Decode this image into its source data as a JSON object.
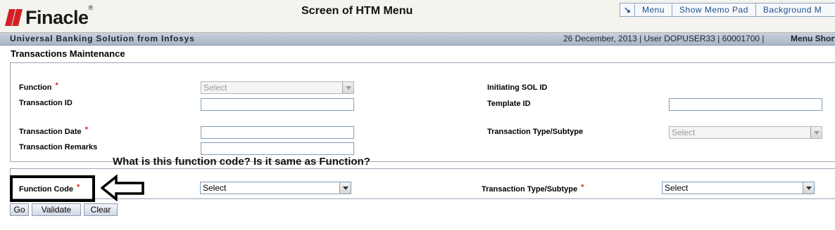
{
  "header": {
    "logo_text": "Finacle",
    "logo_tm": "®",
    "screen_title": "Screen of HTM Menu",
    "menu_items": [
      "Menu",
      "Show Memo Pad",
      "Background M"
    ]
  },
  "status_bar": {
    "product": "Universal Banking Solution from Infosys",
    "info": "26 December, 2013  |  User  DOPUSER33  |  60001700  |",
    "shortcut": "Menu Short"
  },
  "page_title": "Transactions Maintenance",
  "form": {
    "function_label": "Function",
    "function_value": "Select",
    "transaction_id_label": "Transaction ID",
    "transaction_id_value": "",
    "transaction_date_label": "Transaction Date",
    "transaction_date_value": "",
    "transaction_remarks_label": "Transaction Remarks",
    "transaction_remarks_value": "",
    "initiating_sol_label": "Initiating SOL ID",
    "template_id_label": "Template ID",
    "template_id_value": "",
    "txn_type_label": "Transaction Type/Subtype",
    "txn_type_value": "Select",
    "required_mark": "*"
  },
  "criteria": {
    "function_code_label": "Function Code",
    "function_code_value": "Select",
    "txn_type_label": "Transaction Type/Subtype",
    "txn_type_value": "Select"
  },
  "annotation": "What is this function code? Is it same as Function?",
  "buttons": {
    "go": "Go",
    "validate": "Validate",
    "clear": "Clear"
  },
  "colors": {
    "brand_red": "#d41f26",
    "link_blue": "#1d4f8c",
    "required_red": "#e0201b"
  }
}
